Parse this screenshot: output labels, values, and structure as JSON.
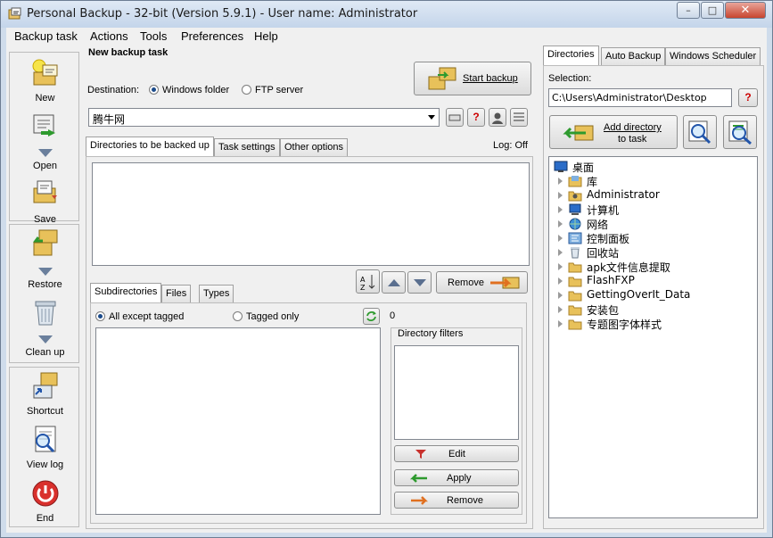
{
  "window": {
    "title": "Personal Backup - 32-bit (Version 5.9.1) - User name: Administrator",
    "minimize": "–",
    "maximize": "□",
    "close": "✕"
  },
  "menu": [
    "Backup task",
    "Actions",
    "Tools",
    "Preferences",
    "Help"
  ],
  "toolbar": {
    "new": "New",
    "open": "Open",
    "save": "Save",
    "restore": "Restore",
    "cleanup": "Clean up",
    "shortcut": "Shortcut",
    "viewlog": "View log",
    "end": "End"
  },
  "task": {
    "heading": "New backup task",
    "start_backup": "Start backup",
    "destination_label": "Destination:",
    "dest_windows": "Windows folder",
    "dest_ftp": "FTP server",
    "destination_value": "腾牛网",
    "help_btn": "?",
    "log_status": "Log: Off"
  },
  "tabs_main": [
    "Directories to be backed up",
    "Task settings",
    "Other options"
  ],
  "dirs_remove": "Remove",
  "subtabs": [
    "Subdirectories",
    "Files",
    "Types"
  ],
  "subdirs": {
    "all_except": "All except tagged",
    "tagged_only": "Tagged only",
    "count": "0",
    "filters_title": "Directory filters",
    "edit": "Edit",
    "apply": "Apply",
    "remove": "Remove"
  },
  "right": {
    "tabs": [
      "Directories",
      "Auto Backup",
      "Windows Scheduler"
    ],
    "selection_label": "Selection:",
    "selection_value": "C:\\Users\\Administrator\\Desktop",
    "help_btn": "?",
    "add_dir_line1": "Add directory",
    "add_dir_line2": "to task",
    "tree_root": "桌面",
    "tree_items": [
      "库",
      "Administrator",
      "计算机",
      "网络",
      "控制面板",
      "回收站",
      "apk文件信息提取",
      "FlashFXP",
      "GettingOverIt_Data",
      "安装包",
      "专题图字体样式"
    ]
  },
  "colors": {
    "accent": "#316ac5",
    "window_frame": "#cfdceb",
    "folder": "#e8c15a",
    "end_button": "#d9302c"
  }
}
